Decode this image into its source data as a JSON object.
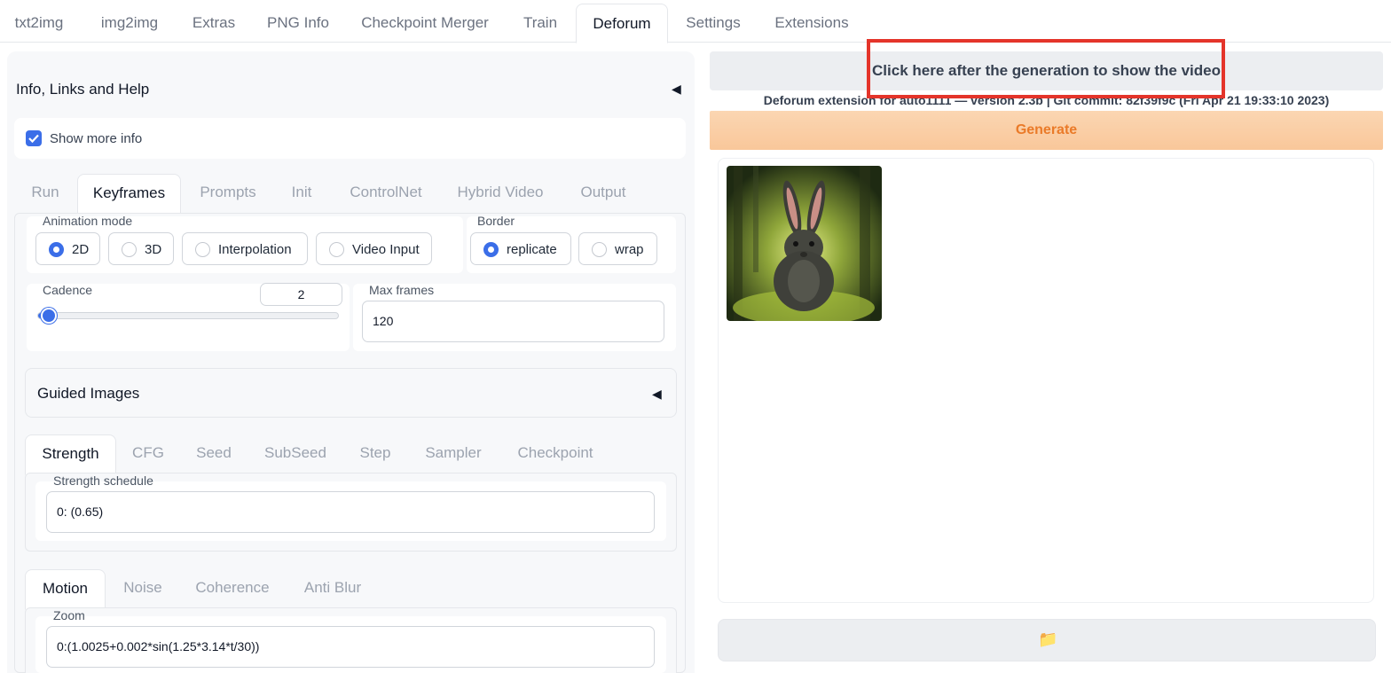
{
  "top_tabs": [
    "txt2img",
    "img2img",
    "Extras",
    "PNG Info",
    "Checkpoint Merger",
    "Train",
    "Deforum",
    "Settings",
    "Extensions"
  ],
  "active_top_tab": "Deforum",
  "left": {
    "info_accordion": {
      "title": "Info, Links and Help",
      "caret": "◀"
    },
    "show_more_info": {
      "label": "Show more info",
      "checked": true
    },
    "main_tabs": [
      "Run",
      "Keyframes",
      "Prompts",
      "Init",
      "ControlNet",
      "Hybrid Video",
      "Output"
    ],
    "active_main_tab": "Keyframes",
    "animation_mode": {
      "label": "Animation mode",
      "options": [
        "2D",
        "3D",
        "Interpolation",
        "Video Input"
      ],
      "selected": "2D"
    },
    "border": {
      "label": "Border",
      "options": [
        "replicate",
        "wrap"
      ],
      "selected": "replicate"
    },
    "cadence": {
      "label": "Cadence",
      "value": "2",
      "level_fraction": 0.04
    },
    "max_frames": {
      "label": "Max frames",
      "value": "120"
    },
    "guided_images": {
      "title": "Guided Images",
      "caret": "◀"
    },
    "schedule_tabs": [
      "Strength",
      "CFG",
      "Seed",
      "SubSeed",
      "Step",
      "Sampler",
      "Checkpoint"
    ],
    "active_schedule_tab": "Strength",
    "strength_schedule": {
      "label": "Strength schedule",
      "value": "0: (0.65)"
    },
    "motion_tabs": [
      "Motion",
      "Noise",
      "Coherence",
      "Anti Blur"
    ],
    "active_motion_tab": "Motion",
    "zoom": {
      "label": "Zoom",
      "value": "0:(1.0025+0.002*sin(1.25*3.14*t/30))"
    }
  },
  "right": {
    "video_button": "Click here after the generation to show the video",
    "version_text": "Deforum extension for auto1111 — version 2.3b | Git commit: 82f39f9c (Fri Apr 21 19:33:10 2023)",
    "generate_label": "Generate",
    "gallery_image": "rabbit-in-forest",
    "folder_icon": "📁"
  },
  "colors": {
    "accent": "#3b6ee8",
    "generate_text": "#ea7a28",
    "highlight_box": "#e4342a"
  }
}
